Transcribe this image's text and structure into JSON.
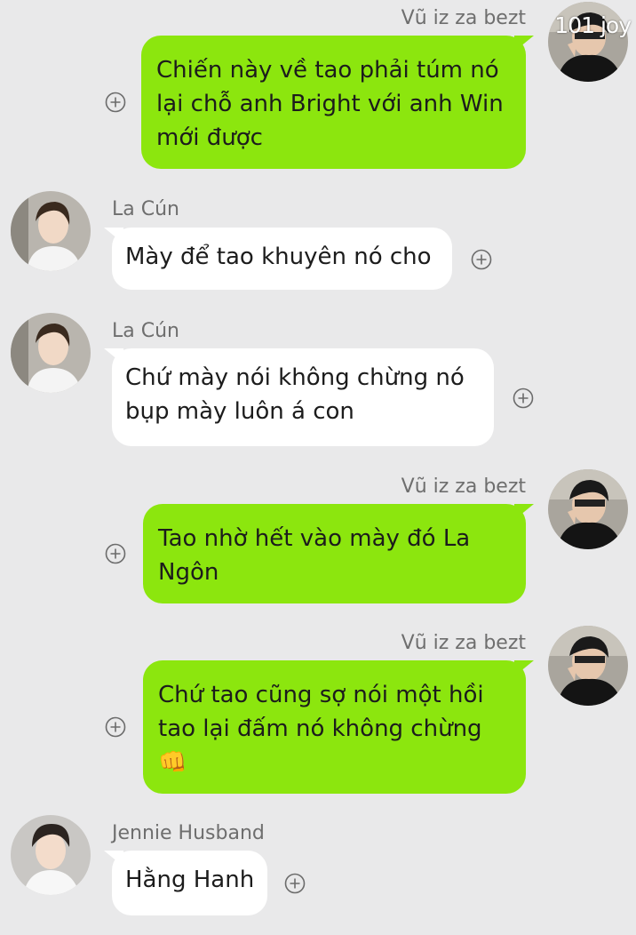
{
  "watermark": "101 joy",
  "messages": [
    {
      "sender": "Vũ iz za bezt",
      "direction": "out",
      "lines": [
        "Chiến này về tao phải túm nó",
        "lại chỗ anh Bright với anh Win",
        "mới được"
      ]
    },
    {
      "sender": "La Cún",
      "direction": "in",
      "lines": [
        "Mày để tao khuyên nó cho"
      ]
    },
    {
      "sender": "La Cún",
      "direction": "in",
      "lines": [
        "Chứ mày nói không chừng nó",
        "bụp mày luôn á con"
      ]
    },
    {
      "sender": "Vũ iz za bezt",
      "direction": "out",
      "lines": [
        "Tao nhờ hết vào mày đó La",
        "Ngôn"
      ]
    },
    {
      "sender": "Vũ iz za bezt",
      "direction": "out",
      "lines": [
        "Chứ tao cũng sợ nói một hồi",
        "tao lại đấm nó không chừng",
        "👊"
      ]
    },
    {
      "sender": "Jennie Husband",
      "direction": "in",
      "lines": [
        "Hằng Hanh"
      ]
    }
  ],
  "colors": {
    "background": "#e9e9ea",
    "outgoing_bubble": "#8ce60e",
    "incoming_bubble": "#ffffff"
  },
  "icons": {
    "add_reaction": "plus-circle-icon",
    "emoji": "fist-emoji"
  }
}
